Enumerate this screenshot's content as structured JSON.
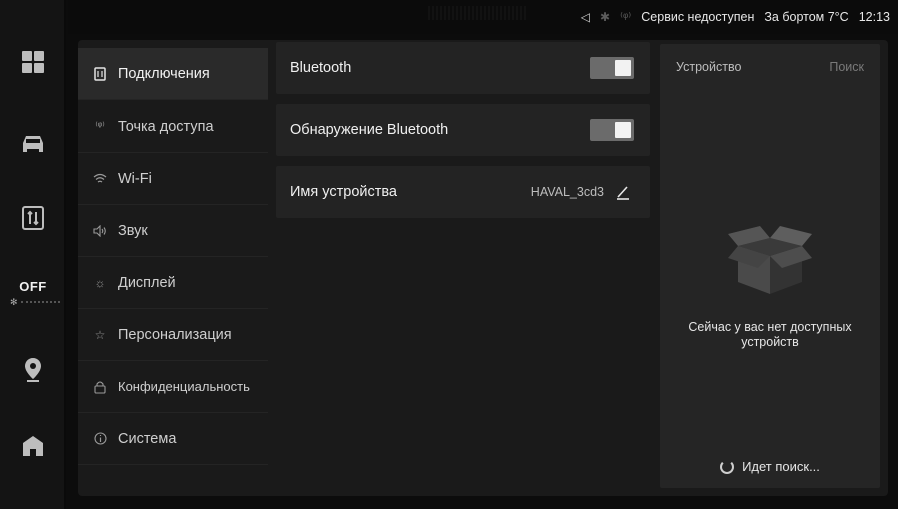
{
  "status_bar": {
    "service_text": "Сервис недоступен",
    "outside_temp": "За бортом 7°C",
    "time": "12:13"
  },
  "dock": {
    "items": [
      {
        "name": "apps",
        "icon": "apps-grid-icon"
      },
      {
        "name": "car",
        "icon": "car-icon"
      },
      {
        "name": "settings",
        "icon": "settings-card-icon"
      },
      {
        "name": "climate",
        "icon": "fan-icon",
        "label": "OFF"
      },
      {
        "name": "navigation",
        "icon": "location-pin-icon"
      },
      {
        "name": "home",
        "icon": "home-icon"
      }
    ]
  },
  "menu": {
    "items": [
      {
        "label": "Подключения",
        "icon": "connections-icon",
        "active": true
      },
      {
        "label": "Точка доступа",
        "icon": "hotspot-icon"
      },
      {
        "label": "Wi-Fi",
        "icon": "wifi-icon"
      },
      {
        "label": "Звук",
        "icon": "sound-icon"
      },
      {
        "label": "Дисплей",
        "icon": "brightness-icon"
      },
      {
        "label": "Персонализация",
        "icon": "personalization-icon"
      },
      {
        "label": "Конфиденциальность",
        "icon": "lock-icon"
      },
      {
        "label": "Система",
        "icon": "info-icon"
      }
    ]
  },
  "content": {
    "bluetooth_label": "Bluetooth",
    "bluetooth_on": true,
    "discovery_label": "Обнаружение Bluetooth",
    "discovery_on": true,
    "device_name_label": "Имя устройства",
    "device_name_value": "HAVAL_3cd3"
  },
  "panel": {
    "title": "Устройство",
    "search": "Поиск",
    "empty_text": "Сейчас у вас нет доступных устройств",
    "searching_text": "Идет поиск..."
  },
  "colors": {
    "background": "#0c0c0c",
    "panel": "#252525",
    "row": "#232323",
    "toggle_track": "#6b6b6b"
  }
}
